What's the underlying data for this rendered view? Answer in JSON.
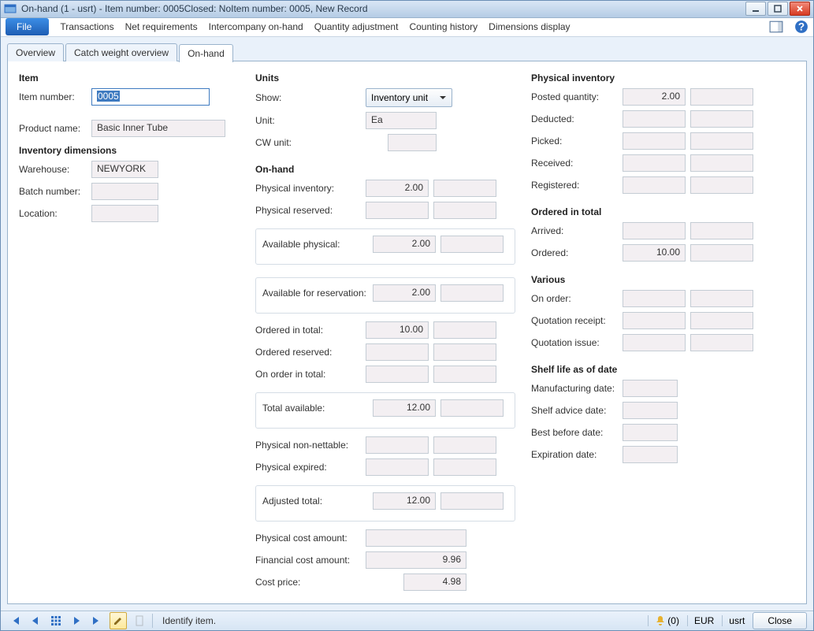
{
  "window": {
    "title": "On-hand (1 - usrt) - Item number: 0005Closed: NoItem number: 0005, New Record"
  },
  "menu": {
    "file": "File",
    "items": [
      "Transactions",
      "Net requirements",
      "Intercompany on-hand",
      "Quantity adjustment",
      "Counting history",
      "Dimensions display"
    ]
  },
  "tabs": {
    "overview": "Overview",
    "catch_weight": "Catch weight overview",
    "on_hand": "On-hand"
  },
  "item": {
    "heading": "Item",
    "item_number_label": "Item number:",
    "item_number_value": "0005",
    "product_name_label": "Product name:",
    "product_name_value": "Basic Inner Tube",
    "inventory_dimensions_heading": "Inventory dimensions",
    "warehouse_label": "Warehouse:",
    "warehouse_value": "NEWYORK",
    "batch_number_label": "Batch number:",
    "batch_number_value": "",
    "location_label": "Location:",
    "location_value": ""
  },
  "units": {
    "heading": "Units",
    "show_label": "Show:",
    "show_value": "Inventory unit",
    "unit_label": "Unit:",
    "unit_value": "Ea",
    "cw_unit_label": "CW unit:",
    "cw_unit_value": ""
  },
  "onhand": {
    "heading": "On-hand",
    "physical_inventory_label": "Physical inventory:",
    "physical_inventory_value": "2.00",
    "physical_reserved_label": "Physical reserved:",
    "physical_reserved_value": "",
    "available_physical_label": "Available physical:",
    "available_physical_value": "2.00",
    "available_reservation_label": "Available for reservation:",
    "available_reservation_value": "2.00",
    "ordered_in_total_label": "Ordered in total:",
    "ordered_in_total_value": "10.00",
    "ordered_reserved_label": "Ordered reserved:",
    "ordered_reserved_value": "",
    "on_order_in_total_label": "On order in total:",
    "on_order_in_total_value": "",
    "total_available_label": "Total available:",
    "total_available_value": "12.00",
    "physical_non_nettable_label": "Physical non-nettable:",
    "physical_non_nettable_value": "",
    "physical_expired_label": "Physical expired:",
    "physical_expired_value": "",
    "adjusted_total_label": "Adjusted total:",
    "adjusted_total_value": "12.00",
    "physical_cost_amount_label": "Physical cost amount:",
    "physical_cost_amount_value": "",
    "financial_cost_amount_label": "Financial cost amount:",
    "financial_cost_amount_value": "9.96",
    "cost_price_label": "Cost price:",
    "cost_price_value": "4.98"
  },
  "physical_inventory": {
    "heading": "Physical inventory",
    "posted_quantity_label": "Posted quantity:",
    "posted_quantity_value": "2.00",
    "deducted_label": "Deducted:",
    "deducted_value": "",
    "picked_label": "Picked:",
    "picked_value": "",
    "received_label": "Received:",
    "received_value": "",
    "registered_label": "Registered:",
    "registered_value": ""
  },
  "ordered_in_total": {
    "heading": "Ordered in total",
    "arrived_label": "Arrived:",
    "arrived_value": "",
    "ordered_label": "Ordered:",
    "ordered_value": "10.00"
  },
  "various": {
    "heading": "Various",
    "on_order_label": "On order:",
    "on_order_value": "",
    "quotation_receipt_label": "Quotation receipt:",
    "quotation_receipt_value": "",
    "quotation_issue_label": "Quotation issue:",
    "quotation_issue_value": ""
  },
  "shelf_life": {
    "heading": "Shelf life as of date",
    "manufacturing_date_label": "Manufacturing date:",
    "shelf_advice_date_label": "Shelf advice date:",
    "best_before_date_label": "Best before date:",
    "expiration_date_label": "Expiration date:"
  },
  "status": {
    "hint": "Identify item.",
    "bell_count": "(0)",
    "currency": "EUR",
    "user": "usrt",
    "close": "Close"
  }
}
